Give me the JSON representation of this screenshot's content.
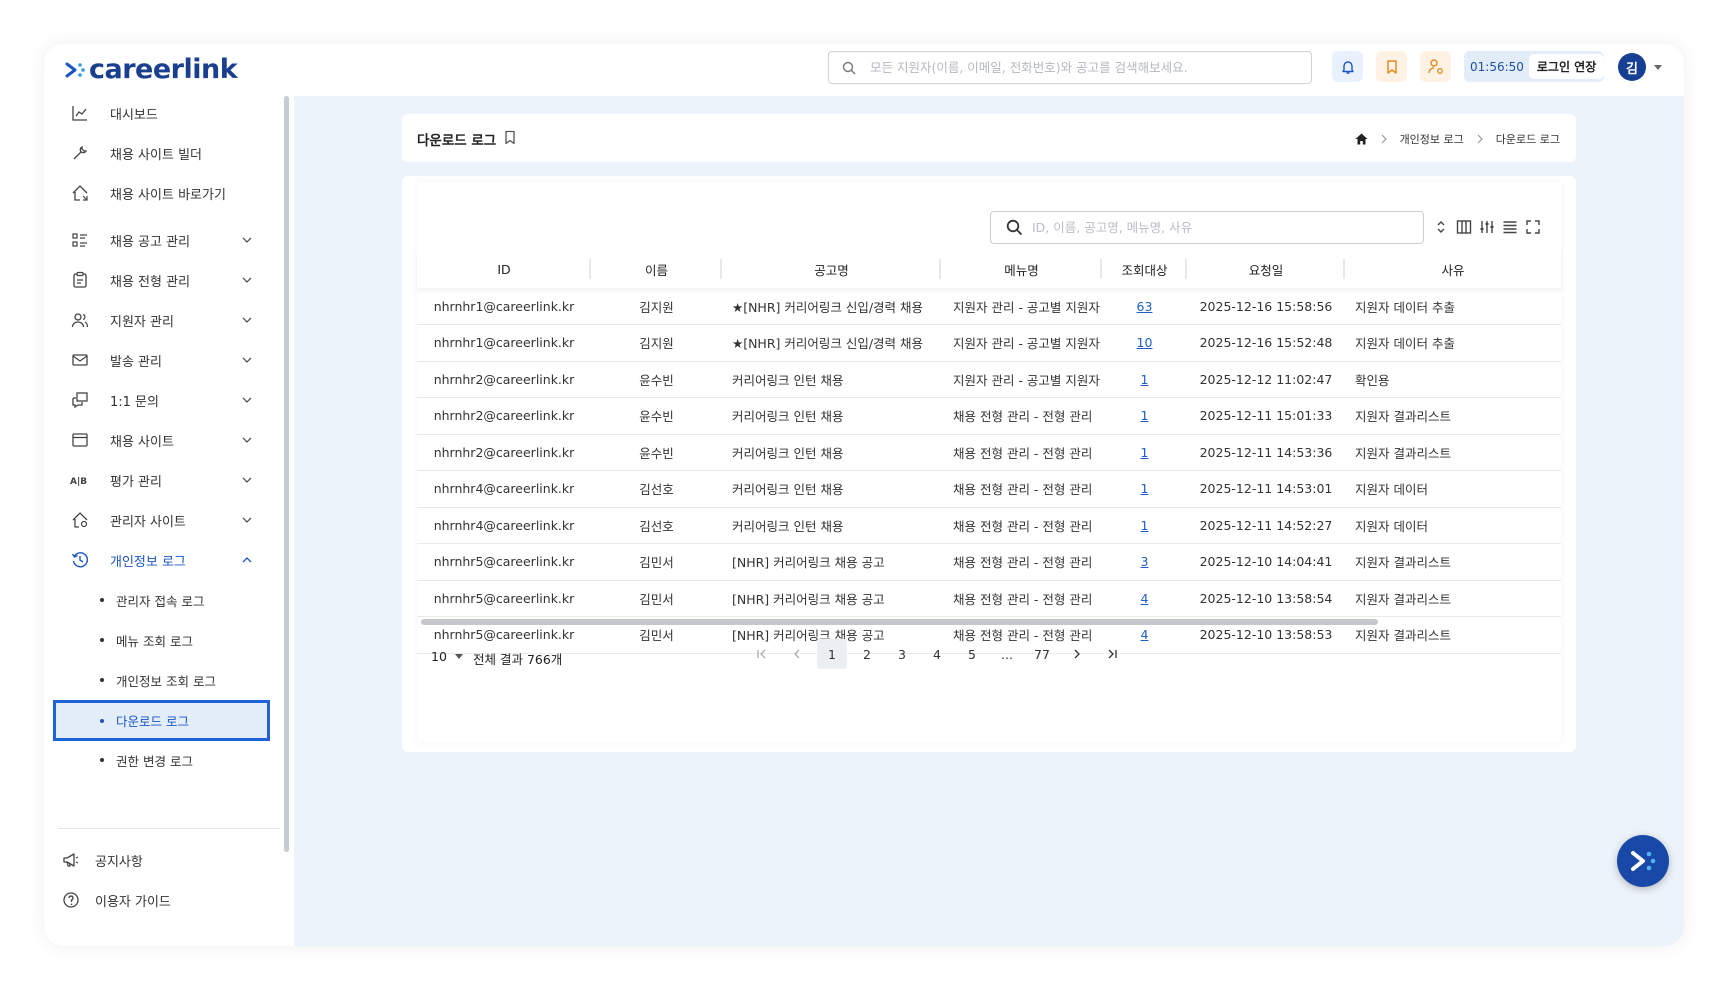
{
  "header": {
    "brand": "careerlink",
    "search_placeholder": "모든 지원자(이름, 이메일, 전화번호)와 공고를 검색해보세요.",
    "session_timer": "01:56:50",
    "extend_label": "로그인 연장",
    "avatar_initial": "김"
  },
  "sidebar": {
    "items": [
      {
        "label": "대시보드",
        "icon": "chart-icon"
      },
      {
        "label": "채용 사이트 빌더",
        "icon": "tools-icon"
      },
      {
        "label": "채용 사이트 바로가기",
        "icon": "home-link-icon"
      },
      {
        "label": "채용 공고 관리",
        "icon": "list-icon"
      },
      {
        "label": "채용 전형 관리",
        "icon": "clipboard-icon"
      },
      {
        "label": "지원자 관리",
        "icon": "users-icon"
      },
      {
        "label": "발송 관리",
        "icon": "mail-icon"
      },
      {
        "label": "1:1 문의",
        "icon": "chat-icon"
      },
      {
        "label": "채용 사이트",
        "icon": "window-icon"
      },
      {
        "label": "평가 관리",
        "icon": "ab-icon"
      },
      {
        "label": "관리자 사이트",
        "icon": "admin-home-icon"
      },
      {
        "label": "개인정보 로그",
        "icon": "history-icon"
      }
    ],
    "sub_items": [
      {
        "label": "관리자 접속 로그"
      },
      {
        "label": "메뉴 조회 로그"
      },
      {
        "label": "개인정보 조회 로그"
      },
      {
        "label": "다운로드 로그"
      },
      {
        "label": "권한 변경 로그"
      }
    ],
    "footer": [
      {
        "label": "공지사항",
        "icon": "megaphone-icon"
      },
      {
        "label": "이용자 가이드",
        "icon": "help-icon"
      }
    ]
  },
  "page": {
    "title": "다운로드 로그",
    "breadcrumb": [
      "개인정보 로그",
      "다운로드 로그"
    ]
  },
  "table": {
    "search_placeholder": "ID, 이름, 공고명, 메뉴명, 사유",
    "columns": [
      "ID",
      "이름",
      "공고명",
      "메뉴명",
      "조회대상",
      "요청일",
      "사유"
    ],
    "rows": [
      {
        "id": "nhrnhr1@careerlink.kr",
        "name": "김지원",
        "job": "★[NHR] 커리어링크 신입/경력 채용",
        "menu": "지원자 관리 - 공고별 지원자",
        "count": "63",
        "date": "2025-12-16 15:58:56",
        "reason": "지원자 데이터 추출"
      },
      {
        "id": "nhrnhr1@careerlink.kr",
        "name": "김지원",
        "job": "★[NHR] 커리어링크 신입/경력 채용",
        "menu": "지원자 관리 - 공고별 지원자",
        "count": "10",
        "date": "2025-12-16 15:52:48",
        "reason": "지원자 데이터 추출"
      },
      {
        "id": "nhrnhr2@careerlink.kr",
        "name": "윤수빈",
        "job": "커리어링크 인턴 채용",
        "menu": "지원자 관리 - 공고별 지원자",
        "count": "1",
        "date": "2025-12-12 11:02:47",
        "reason": "확인용"
      },
      {
        "id": "nhrnhr2@careerlink.kr",
        "name": "윤수빈",
        "job": "커리어링크 인턴 채용",
        "menu": "채용 전형 관리 - 전형 관리",
        "count": "1",
        "date": "2025-12-11 15:01:33",
        "reason": "지원자 결과리스트"
      },
      {
        "id": "nhrnhr2@careerlink.kr",
        "name": "윤수빈",
        "job": "커리어링크 인턴 채용",
        "menu": "채용 전형 관리 - 전형 관리",
        "count": "1",
        "date": "2025-12-11 14:53:36",
        "reason": "지원자 결과리스트"
      },
      {
        "id": "nhrnhr4@careerlink.kr",
        "name": "김선호",
        "job": "커리어링크 인턴 채용",
        "menu": "채용 전형 관리 - 전형 관리",
        "count": "1",
        "date": "2025-12-11 14:53:01",
        "reason": "지원자 데이터"
      },
      {
        "id": "nhrnhr4@careerlink.kr",
        "name": "김선호",
        "job": "커리어링크 인턴 채용",
        "menu": "채용 전형 관리 - 전형 관리",
        "count": "1",
        "date": "2025-12-11 14:52:27",
        "reason": "지원자 데이터"
      },
      {
        "id": "nhrnhr5@careerlink.kr",
        "name": "김민서",
        "job": "[NHR] 커리어링크 채용 공고",
        "menu": "채용 전형 관리 - 전형 관리",
        "count": "3",
        "date": "2025-12-10 14:04:41",
        "reason": "지원자 결과리스트"
      },
      {
        "id": "nhrnhr5@careerlink.kr",
        "name": "김민서",
        "job": "[NHR] 커리어링크 채용 공고",
        "menu": "채용 전형 관리 - 전형 관리",
        "count": "4",
        "date": "2025-12-10 13:58:54",
        "reason": "지원자 결과리스트"
      },
      {
        "id": "nhrnhr5@careerlink.kr",
        "name": "김민서",
        "job": "[NHR] 커리어링크 채용 공고",
        "menu": "채용 전형 관리 - 전형 관리",
        "count": "4",
        "date": "2025-12-10 13:58:53",
        "reason": "지원자 결과리스트"
      }
    ]
  },
  "pagination": {
    "page_size": "10",
    "total_label": "전체 결과 766개",
    "pages": [
      "1",
      "2",
      "3",
      "4",
      "5",
      "...",
      "77"
    ],
    "current": "1"
  },
  "colors": {
    "brand": "#1b3f8f",
    "accent": "#2063d8",
    "link": "#1d5fc7",
    "main_bg": "#edf3fb"
  }
}
